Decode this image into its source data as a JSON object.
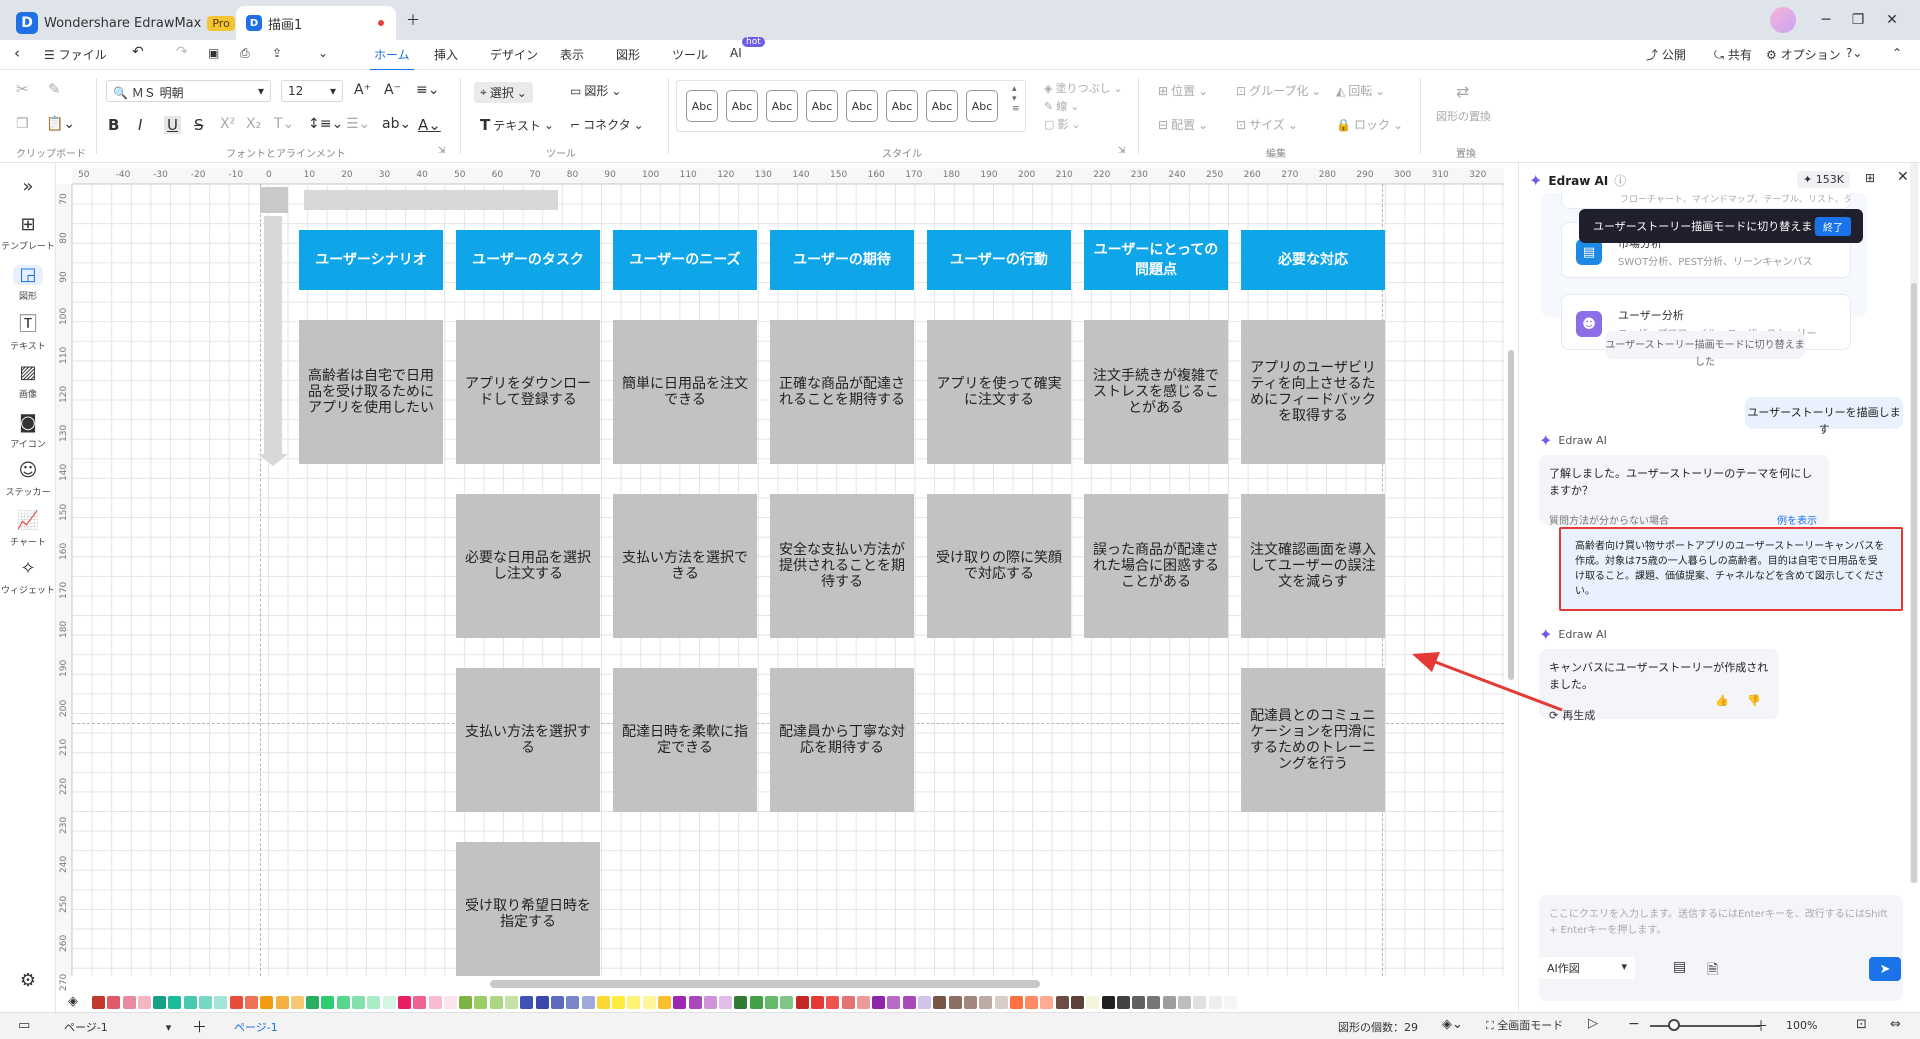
{
  "app": {
    "name": "Wondershare EdrawMax",
    "badge": "Pro",
    "doc_tab": "描画1"
  },
  "menu": {
    "file": "ファイル",
    "tabs": [
      "ホーム",
      "挿入",
      "デザイン",
      "表示",
      "図形",
      "ツール",
      "AI"
    ],
    "ai_badge": "hot",
    "right": [
      "公開",
      "共有",
      "オプション"
    ]
  },
  "ribbon": {
    "font": "ＭＳ 明朝",
    "size": "12",
    "select": "選択",
    "shape": "図形",
    "text": "テキスト",
    "connector": "コネクタ",
    "style_sample": "Abc",
    "fill": "塗りつぶし",
    "line": "線",
    "shadow": "影",
    "position": "位置",
    "align": "配置",
    "group": "グループ化",
    "size_btn": "サイズ",
    "rotate": "回転",
    "lock": "ロック",
    "replace": "図形の置換",
    "groups": [
      "クリップボード",
      "フォントとアラインメント",
      "ツール",
      "スタイル",
      "編集",
      "置換"
    ]
  },
  "leftbar": [
    "テンプレート",
    "図形",
    "テキスト",
    "画像",
    "アイコン",
    "ステッカー",
    "チャート",
    "ウィジェット"
  ],
  "ruler_top": [
    "50",
    "-40",
    "-30",
    "-20",
    "-10",
    "0",
    "10",
    "20",
    "30",
    "40",
    "50",
    "60",
    "70",
    "80",
    "90",
    "100",
    "110",
    "120",
    "130",
    "140",
    "150",
    "160",
    "170",
    "180",
    "190",
    "200",
    "210",
    "220",
    "230",
    "240",
    "250",
    "260",
    "270",
    "280",
    "290",
    "300",
    "310",
    "320"
  ],
  "ruler_left": [
    "70",
    "80",
    "90",
    "100",
    "110",
    "120",
    "130",
    "140",
    "150",
    "160",
    "170",
    "180",
    "190",
    "200",
    "210",
    "220",
    "230",
    "240",
    "250",
    "260",
    "270"
  ],
  "diagram": {
    "headers": [
      "ユーザーシナリオ",
      "ユーザーのタスク",
      "ユーザーのニーズ",
      "ユーザーの期待",
      "ユーザーの行動",
      "ユーザーにとっての問題点",
      "必要な対応"
    ],
    "rows": [
      [
        "高齢者は自宅で日用品を受け取るためにアプリを使用したい",
        "アプリをダウンロードして登録する",
        "簡単に日用品を注文できる",
        "正確な商品が配達されることを期待する",
        "アプリを使って確実に注文する",
        "注文手続きが複雑でストレスを感じることがある",
        "アプリのユーザビリティを向上させるためにフィードバックを取得する"
      ],
      [
        "",
        "必要な日用品を選択し注文する",
        "支払い方法を選択できる",
        "安全な支払い方法が提供されることを期待する",
        "受け取りの際に笑顔で対応する",
        "誤った商品が配達された場合に困惑することがある",
        "注文確認画面を導入してユーザーの誤注文を減らす"
      ],
      [
        "",
        "支払い方法を選択する",
        "配達日時を柔軟に指定できる",
        "配達員から丁寧な対応を期待する",
        "",
        "",
        "配達員とのコミュニケーションを円滑にするためのトレーニングを行う"
      ],
      [
        "",
        "受け取り希望日時を指定する",
        "",
        "",
        "",
        "",
        ""
      ]
    ]
  },
  "palette": [
    "#c0392b",
    "#e05a6a",
    "#e88aa0",
    "#f3b6c3",
    "#16a085",
    "#1abc9c",
    "#48c9b0",
    "#76d7c4",
    "#a3e4d7",
    "#e74c3c",
    "#f0715a",
    "#f39c12",
    "#f5b041",
    "#f7c873",
    "#27ae60",
    "#2ecc71",
    "#58d68d",
    "#82e0aa",
    "#abebc6",
    "#d5f5e3",
    "#e91e63",
    "#f06292",
    "#f8bbd0",
    "#fce4ec",
    "#7cb342",
    "#9ccc65",
    "#aed581",
    "#c5e1a5",
    "#3f51b5",
    "#3949ab",
    "#5c6bc0",
    "#7986cb",
    "#9fa8da",
    "#fdd835",
    "#ffeb3b",
    "#fff176",
    "#fff59d",
    "#fbc02d",
    "#9c27b0",
    "#ab47bc",
    "#ce93d8",
    "#e1bee7",
    "#2e7d32",
    "#43a047",
    "#66bb6a",
    "#81c784",
    "#c62828",
    "#e53935",
    "#ef5350",
    "#e57373",
    "#ef9a9a",
    "#8e24aa",
    "#ba68c8",
    "#ab47bc",
    "#d1c4e9",
    "#795548",
    "#8d6e63",
    "#a1887f",
    "#bcaaa4",
    "#d7ccc8",
    "#ff7043",
    "#ff8a65",
    "#ffab91",
    "#6d4c41",
    "#5d4037",
    "#f5f5dc",
    "#212121",
    "#424242",
    "#616161",
    "#757575",
    "#9e9e9e",
    "#bdbdbd",
    "#e0e0e0",
    "#eeeeee",
    "#f5f5f5"
  ],
  "status": {
    "page_select": "ページ-1",
    "page_tab": "ページ-1",
    "shape_count": "図形の個数：29",
    "fullscreen": "全画面モード",
    "zoom": "100%"
  },
  "ai": {
    "title": "Edraw AI",
    "credits": "153K",
    "cut_off_text": "フローチャート、マインドマップ、テーブル、リスト、タイム",
    "tooltip": "ユーザーストーリー描画モードに切り替えました",
    "tooltip_btn": "終了",
    "suggestions": [
      {
        "title": "市場分析",
        "sub": "SWOT分析、PEST分析、リーンキャンバス",
        "color": "#1e88e5"
      },
      {
        "title": "ユーザー分析",
        "sub": "ユーザープロファイル、ユーザーストーリー",
        "color": "#8e6ee8"
      }
    ],
    "system_note": "ユーザーストーリー描画モードに切り替えました",
    "user_msg_1": "ユーザーストーリーを描画します",
    "bot_name": "Edraw AI",
    "bot_msg_1": "了解しました。ユーザーストーリーのテーマを何にしますか？",
    "bot_hint": "質問方法が分からない場合",
    "bot_hint_link": "例を表示",
    "user_msg_2": "高齢者向け買い物サポートアプリのユーザーストーリーキャンバスを作成。対象は75歳の一人暮らしの高齢者。目的は自宅で日用品を受け取ること。課題、価値提案、チャネルなどを含めて図示してください。",
    "bot_msg_2": "キャンバスにユーザーストーリーが作成されました。",
    "regen": "再生成",
    "input_placeholder": "ここにクエリを入力します。送信するにはEnterキーを、改行するにはShift + Enterキーを押します。",
    "mode": "AI作図"
  }
}
